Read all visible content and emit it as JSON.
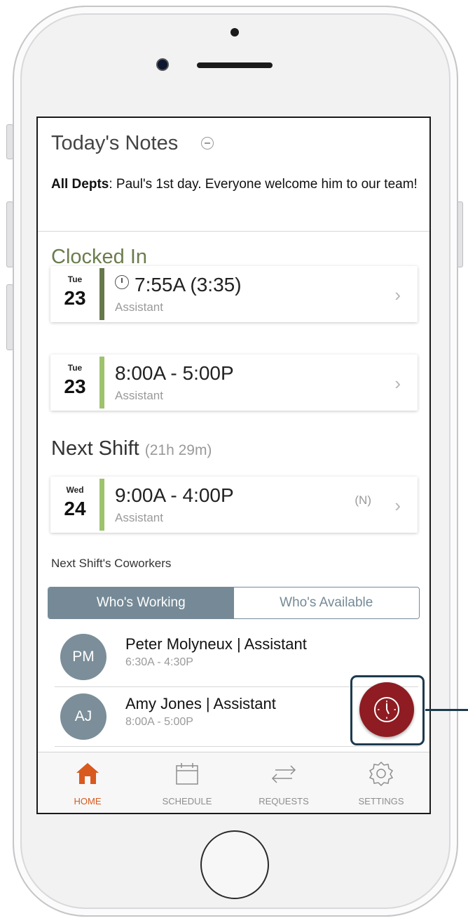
{
  "notes": {
    "title": "Today's Notes",
    "dept_label": "All Depts",
    "message": ": Paul's 1st day. Everyone welcome him to our team!"
  },
  "clocked_in": {
    "title": "Clocked In",
    "cards": [
      {
        "dow": "Tue",
        "day": "23",
        "time": "7:55A (3:35)",
        "role": "Assistant",
        "bar_color": "#66794a",
        "clock_icon": "clock-icon"
      },
      {
        "dow": "Tue",
        "day": "23",
        "time": "8:00A - 5:00P",
        "role": "Assistant",
        "bar_color": "#9ec26e"
      }
    ]
  },
  "next_shift": {
    "title": "Next Shift",
    "countdown": "(21h 29m)",
    "card": {
      "dow": "Wed",
      "day": "24",
      "time": "9:00A - 4:00P",
      "tag": "(N)",
      "role": "Assistant",
      "bar_color": "#9ec26e"
    }
  },
  "coworkers": {
    "label": "Next Shift's Coworkers",
    "segments": [
      {
        "label": "Who's Working",
        "active": true
      },
      {
        "label": "Who's Available",
        "active": false
      }
    ],
    "list": [
      {
        "initials": "PM",
        "name": "Peter Molyneux | Assistant",
        "hours": "6:30A - 4:30P"
      },
      {
        "initials": "AJ",
        "name": "Amy Jones | Assistant",
        "hours": "8:00A - 5:00P"
      }
    ]
  },
  "fab": {
    "icon": "clock-icon",
    "color": "#8e1c22"
  },
  "tabbar": {
    "items": [
      {
        "label": "HOME",
        "icon": "home-icon",
        "active": true
      },
      {
        "label": "SCHEDULE",
        "icon": "calendar-icon",
        "active": false
      },
      {
        "label": "REQUESTS",
        "icon": "swap-arrows-icon",
        "active": false
      },
      {
        "label": "SETTINGS",
        "icon": "gear-icon",
        "active": false
      }
    ],
    "active_color": "#d85a1f"
  }
}
